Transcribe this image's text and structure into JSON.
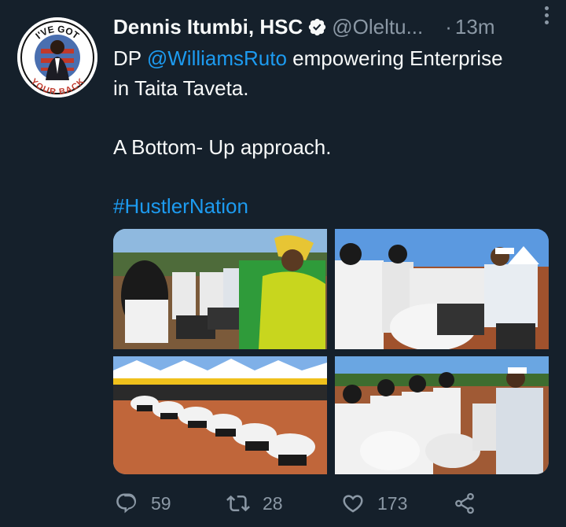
{
  "tweet": {
    "author_name": "Dennis Itumbi, HSC",
    "verified_icon": "verified-badge-icon",
    "handle": "@Oleltu...",
    "separator": "·",
    "time": "13m",
    "avatar_text_top": "I'VE GOT",
    "avatar_text_bottom": "YOUR BACK",
    "text": {
      "prefix": "DP ",
      "mention": "@WilliamsRuto",
      "line1_rest": " empowering Enterprise",
      "line2": "in Taita Taveta.",
      "line4": "A Bottom- Up approach.",
      "hashtag": "#HustlerNation"
    },
    "media": [
      {
        "icon": "photo-laptop-handover"
      },
      {
        "icon": "photo-motorbike-inspection"
      },
      {
        "icon": "photo-motorbikes-lined-up"
      },
      {
        "icon": "photo-crowd-with-motorbikes"
      }
    ],
    "actions": {
      "replies": "59",
      "retweets": "28",
      "likes": "173"
    },
    "colors": {
      "background": "#15202b",
      "accent": "#1d9bf0",
      "muted": "#8b98a5",
      "text": "#f7f9f9"
    }
  }
}
